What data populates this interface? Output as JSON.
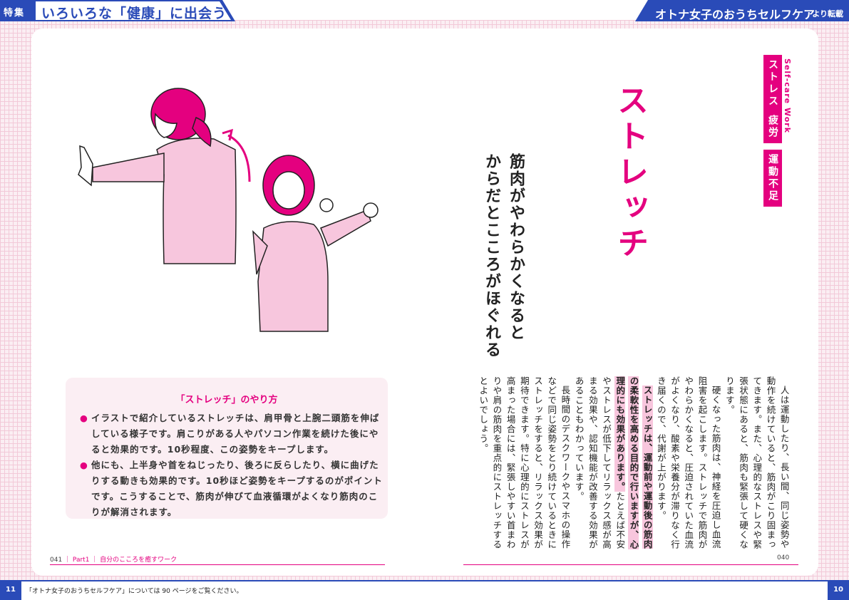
{
  "header": {
    "tag": "特集",
    "feature_title": "いろいろな「健康」に出会う",
    "source_title": "オトナ女子のおうちセルフケア",
    "source_suffix": "より転載"
  },
  "article": {
    "section_label": "Self-care Work",
    "tags": [
      "ストレス",
      "疲労",
      "運動不足"
    ],
    "title": "ストレッチ",
    "subtitle_line1": "筋肉がやわらかくなると",
    "subtitle_line2": "からだとこころがほぐれる",
    "body_p1": "人は運動したり、長い間、同じ姿勢や動作を続けていると、筋肉がこり固まってきます。また、心理的なストレスや緊張状態にあると、筋肉も緊張して硬くなります。",
    "body_p2": "硬くなった筋肉は、神経を圧迫し血流阻害を起こします。ストレッチで筋肉がやわらかくなると、圧迫されていた血流がよくなり、酸素や栄養分が滞りなく行き届くので、代謝が上がります。",
    "body_p3_highlight": "ストレッチは、運動前や運動後の筋肉の柔軟性を高める目的で行いますが、心理的にも効果があります。",
    "body_p3_rest": "たとえば不安やストレスが低下してリラックス感が高まる効果や、認知機能が改善する効果があることもわかっています。",
    "body_p4": "長時間のデスクワークやスマホの操作などで同じ姿勢をとり続けているときにストレッチをすると、リラックス効果が期待できます。特に心理的にストレスが高まった場合には、緊張しやすい首まわりや肩の筋肉を重点的にストレッチするとよいでしょう。"
  },
  "tips": {
    "title": "「ストレッチ」のやり方",
    "bullet": "●",
    "item1": "イラストで紹介しているストレッチは、肩甲骨と上腕二頭筋を伸ばしている様子です。肩こりがある人やパソコン作業を続けた後にやると効果的です。10秒程度、この姿勢をキープします。",
    "item2": "他にも、上半身や首をねじったり、後ろに反らしたり、横に曲げたりする動きも効果的です。10秒ほど姿勢をキープするのがポイントです。こうすることで、筋肉が伸びて血液循環がよくなり筋肉のこりが解消されます。"
  },
  "footer": {
    "left_page": "041",
    "left_section": "｜ Part1 ｜ 自分のこころを癒すワーク",
    "right_page": "040"
  },
  "bottom": {
    "left_num": "11",
    "right_num": "10",
    "note": "「オトナ女子のおうちセルフケア」については 90 ページをご覧ください。"
  },
  "colors": {
    "accent_pink": "#e4007f",
    "brand_blue": "#2a4bb8",
    "light_pink": "#fbeef3"
  }
}
